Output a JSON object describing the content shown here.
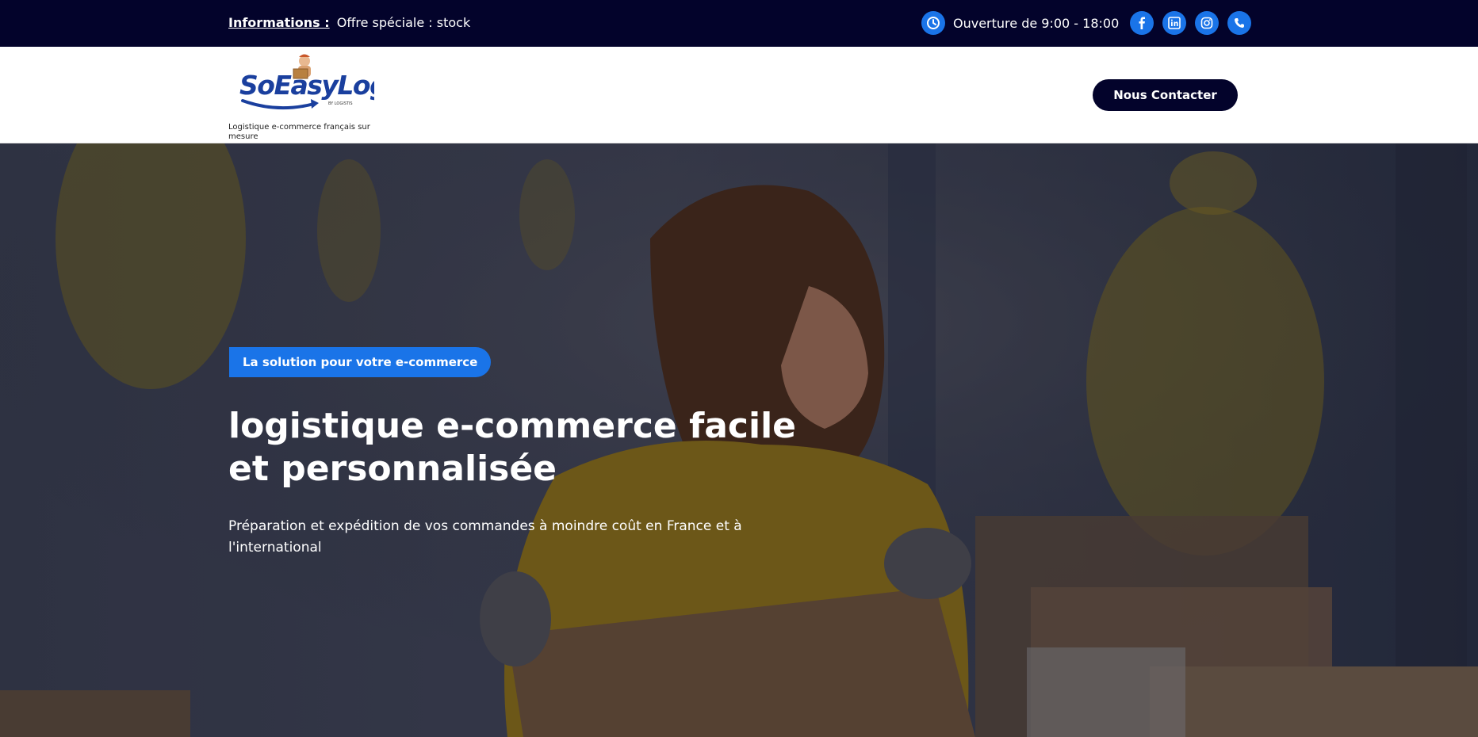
{
  "topbar": {
    "info_label": "Informations :",
    "info_text": "Offre spéciale : stock",
    "hours_icon": "clock-icon",
    "hours_text": "Ouverture de 9:00 - 18:00",
    "socials": [
      "facebook-icon",
      "linkedin-icon",
      "instagram-icon",
      "phone-icon"
    ]
  },
  "header": {
    "logo_text": "SoEasyLog",
    "logo_subtext": "BY LOGISTIS",
    "tagline": "Logistique e-commerce français sur mesure",
    "contact_button": "Nous Contacter"
  },
  "hero": {
    "badge": "La solution pour votre e-commerce",
    "title_line1": "logistique e-commerce facile",
    "title_line2": "et personnalisée",
    "subtitle": "Préparation et expédition de vos commandes à moindre coût en France et à l'international"
  },
  "colors": {
    "topbar_bg": "#03032b",
    "accent_blue": "#1a74e8",
    "button_bg": "#03032b"
  }
}
